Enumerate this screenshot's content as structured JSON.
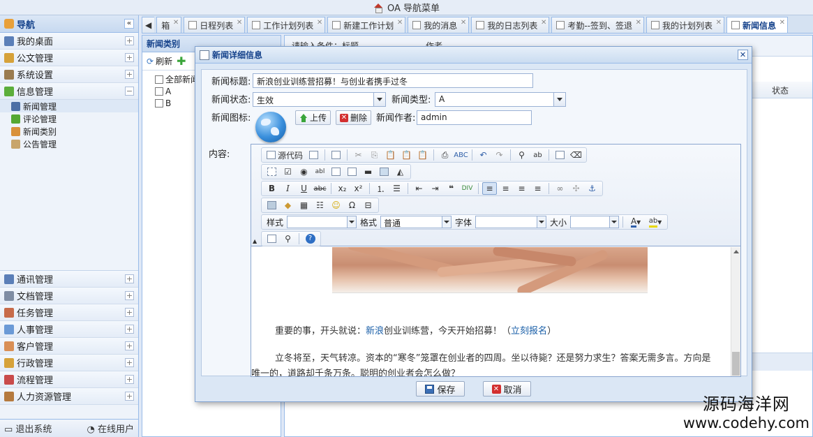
{
  "app": {
    "title": "OA  导航菜单"
  },
  "nav": {
    "header": "导航",
    "items": [
      {
        "label": "我的桌面",
        "icon": "desktop-icon",
        "color": "#5b7fb8",
        "toggle": "+"
      },
      {
        "label": "公文管理",
        "icon": "document-icon",
        "color": "#d6a23a",
        "toggle": "+"
      },
      {
        "label": "系统设置",
        "icon": "wrench-icon",
        "color": "#9a7b4f",
        "toggle": "+"
      },
      {
        "label": "信息管理",
        "icon": "chat-icon",
        "color": "#5cae3b",
        "toggle": "−"
      }
    ],
    "sub_items": [
      {
        "label": "新闻管理",
        "icon": "news-icon",
        "color": "#4c6fa5"
      },
      {
        "label": "评论管理",
        "icon": "comment-icon",
        "color": "#56a832"
      },
      {
        "label": "新闻类别",
        "icon": "users-icon",
        "color": "#d9913a"
      },
      {
        "label": "公告管理",
        "icon": "clipboard-icon",
        "color": "#c8a56b"
      }
    ],
    "bottom_items": [
      {
        "label": "通讯管理",
        "icon": "phone-icon",
        "color": "#5b7fb8",
        "toggle": "+"
      },
      {
        "label": "文档管理",
        "icon": "file-icon",
        "color": "#7f8da3",
        "toggle": "+"
      },
      {
        "label": "任务管理",
        "icon": "task-icon",
        "color": "#c76b4a",
        "toggle": "+"
      },
      {
        "label": "人事管理",
        "icon": "people-icon",
        "color": "#6b9ad6",
        "toggle": "+"
      },
      {
        "label": "客户管理",
        "icon": "customer-icon",
        "color": "#d98f55",
        "toggle": "+"
      },
      {
        "label": "行政管理",
        "icon": "book-icon",
        "color": "#d6a23a",
        "toggle": "+"
      },
      {
        "label": "流程管理",
        "icon": "flow-icon",
        "color": "#c94b4b",
        "toggle": "+"
      },
      {
        "label": "人力资源管理",
        "icon": "briefcase-icon",
        "color": "#b57a3e",
        "toggle": "+"
      }
    ],
    "footer": {
      "logout": "退出系统",
      "online": "在线用户"
    }
  },
  "tabs": [
    {
      "label": "箱",
      "active": false
    },
    {
      "label": "日程列表",
      "active": false
    },
    {
      "label": "工作计划列表",
      "active": false
    },
    {
      "label": "新建工作计划",
      "active": false
    },
    {
      "label": "我的消息",
      "active": false
    },
    {
      "label": "我的日志列表",
      "active": false
    },
    {
      "label": "考勤--签到、签退",
      "active": false
    },
    {
      "label": "我的计划列表",
      "active": false
    },
    {
      "label": "新闻信息",
      "active": true
    }
  ],
  "category_panel": {
    "title": "新闻类别",
    "refresh": "刷新",
    "tree": [
      "全部新闻",
      "A",
      "B"
    ]
  },
  "list_panel": {
    "query_label": "请输入条件：标题",
    "author_label": "作者",
    "status_col": "状态"
  },
  "dialog": {
    "title": "新闻详细信息",
    "labels": {
      "title": "新闻标题:",
      "status": "新闻状态:",
      "type": "新闻类型:",
      "icon": "新闻图标:",
      "author": "新闻作者:",
      "content": "内容:"
    },
    "values": {
      "title": "新浪创业训练营招募！与创业者携手过冬",
      "status": "生效",
      "type": "A",
      "author": "admin"
    },
    "buttons": {
      "upload": "上传",
      "delete": "删除",
      "save": "保存",
      "cancel": "取消"
    }
  },
  "editor": {
    "source_label": "源代码",
    "style_label": "样式",
    "format_label": "格式",
    "format_value": "普通",
    "font_label": "字体",
    "size_label": "大小",
    "paragraph1_a": "重要的事，开头就说：",
    "paragraph1_link1": "新浪",
    "paragraph1_b": "创业训练营，今天开始招募！（",
    "paragraph1_link2": "立刻报名",
    "paragraph1_c": "）",
    "paragraph2": "立冬将至，天气转凉。资本的“寒冬”笼罩在创业者的四周。坐以待毙？还是努力求生？答案无需多言。方向是唯一的，道路却千条万条。聪明的创业者会怎么做？"
  },
  "watermark": {
    "line1": "源码海洋网",
    "line2": "www.codehy.com"
  }
}
